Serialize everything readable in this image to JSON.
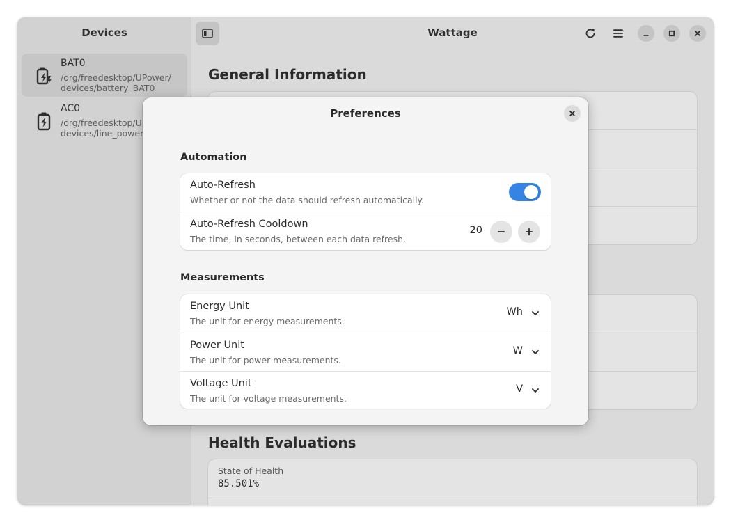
{
  "sidebar": {
    "title": "Devices",
    "devices": [
      {
        "name": "BAT0",
        "path_line1": "/org/freedesktop/UPower/",
        "path_line2": "devices/battery_BAT0",
        "icon": "battery-charging-icon"
      },
      {
        "name": "AC0",
        "path_line1": "/org/freedesktop/UPower/",
        "path_line2": "devices/line_power_AC0",
        "icon": "line-power-icon"
      }
    ]
  },
  "header": {
    "title": "Wattage",
    "icons": [
      "sidebar-toggle-icon",
      "refresh-icon",
      "menu-icon",
      "minimize-icon",
      "maximize-icon",
      "close-icon"
    ]
  },
  "main": {
    "sections": {
      "general": "General Information",
      "health": "Health Evaluations"
    },
    "health_rows": [
      {
        "label": "State of Health",
        "value": "85.501%"
      }
    ]
  },
  "dialog": {
    "title": "Preferences",
    "groups": {
      "automation": {
        "title": "Automation",
        "auto_refresh": {
          "title": "Auto-Refresh",
          "subtitle": "Whether or not the data should refresh automatically.",
          "enabled": true
        },
        "cooldown": {
          "title": "Auto-Refresh Cooldown",
          "subtitle": "The time, in seconds, between each data refresh.",
          "value": "20"
        }
      },
      "measurements": {
        "title": "Measurements",
        "energy": {
          "title": "Energy Unit",
          "subtitle": "The unit for energy measurements.",
          "value": "Wh"
        },
        "power": {
          "title": "Power Unit",
          "subtitle": "The unit for power measurements.",
          "value": "W"
        },
        "voltage": {
          "title": "Voltage Unit",
          "subtitle": "The unit for voltage measurements.",
          "value": "V"
        }
      }
    }
  },
  "colors": {
    "accent": "#3584e4",
    "sidebar_bg": "#d2d2d2",
    "content_bg": "#dadada",
    "dialog_bg": "#f4f4f4"
  }
}
